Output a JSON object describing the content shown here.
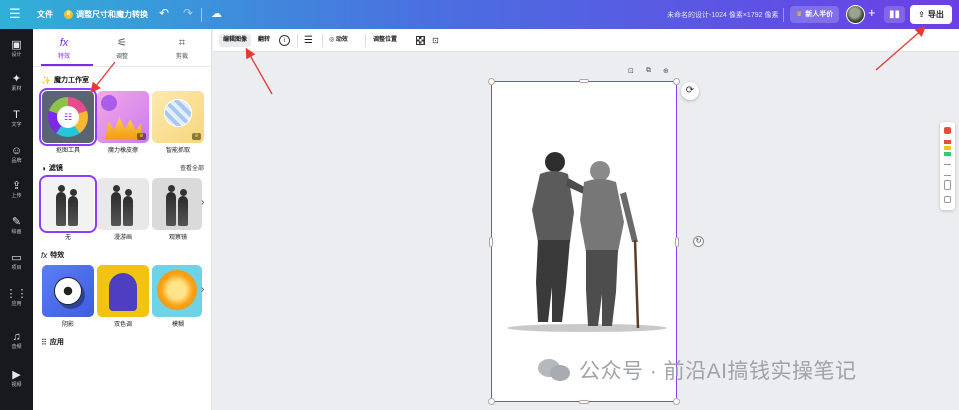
{
  "topbar": {
    "menu_icon": "☰",
    "file_label": "文件",
    "resize_label": "调整尺寸和魔力转换",
    "doc_info": "未命名的设计-1024 像素×1792 像素",
    "trial_label": "新人半价",
    "export_label": "导出",
    "accent": "#7d2ae8"
  },
  "rail": [
    {
      "icon": "▣",
      "label": "设计"
    },
    {
      "icon": "✦",
      "label": "素材"
    },
    {
      "icon": "T",
      "label": "文字"
    },
    {
      "icon": "☺",
      "label": "品牌"
    },
    {
      "icon": "⇪",
      "label": "上传"
    },
    {
      "icon": "✎",
      "label": "绘画"
    },
    {
      "icon": "▭",
      "label": "项目"
    },
    {
      "icon": "⋮⋮",
      "label": "应用"
    },
    {
      "icon": "♫",
      "label": "音频"
    },
    {
      "icon": "▶",
      "label": "视频"
    }
  ],
  "panel": {
    "tabs": [
      {
        "icon": "fx",
        "label": "特效"
      },
      {
        "icon": "⚟",
        "label": "调整"
      },
      {
        "icon": "⌗",
        "label": "剪裁"
      }
    ],
    "magic_studio": {
      "heading": "魔力工作室",
      "items": [
        {
          "label": "抠图工具"
        },
        {
          "label": "魔力橡皮擦"
        },
        {
          "label": "智能抓取"
        }
      ]
    },
    "filters": {
      "heading": "滤镜",
      "see_all": "查看全部",
      "items": [
        {
          "label": "无"
        },
        {
          "label": "漫游画"
        },
        {
          "label": "观察镜"
        }
      ]
    },
    "effects": {
      "heading": "特效",
      "items": [
        {
          "label": "阴影"
        },
        {
          "label": "双色调"
        },
        {
          "label": "模糊"
        }
      ]
    },
    "apps": {
      "heading": "应用"
    }
  },
  "context_toolbar": {
    "edit_image": "编辑图像",
    "flip": "翻转",
    "animate": "动效",
    "position": "调整位置"
  },
  "watermark": {
    "text": "公众号 · 前沿AI搞钱实操笔记"
  }
}
